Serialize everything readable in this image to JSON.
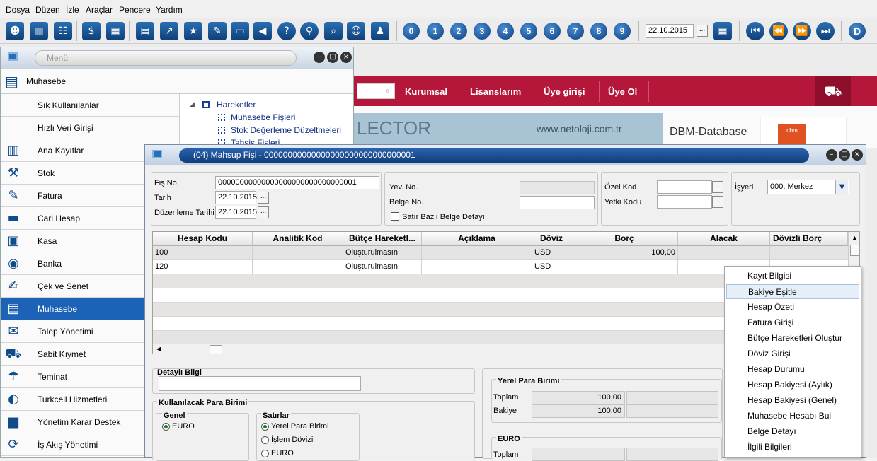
{
  "menubar": [
    "Dosya",
    "Düzen",
    "İzle",
    "Araçlar",
    "Pencere",
    "Yardım"
  ],
  "toolbar": {
    "icons": [
      "users-icon",
      "buildings-icon",
      "hierarchy-icon",
      "money-bag-icon",
      "calculator-icon",
      "calendar-icon",
      "chart-icon",
      "star-document-icon",
      "document-edit-icon",
      "folder-add-icon",
      "megaphone-icon",
      "help-icon",
      "connection-icon",
      "search-icon",
      "group-icon",
      "user-support-icon"
    ],
    "numbers": [
      "0",
      "1",
      "2",
      "3",
      "4",
      "5",
      "6",
      "7",
      "8",
      "9"
    ],
    "date": "22.10.2015",
    "date_btn": "...",
    "nav": [
      "⏮",
      "⏪",
      "⏩",
      "⏭"
    ],
    "d_button": "D"
  },
  "website": {
    "nav": [
      "Kurumsal",
      "Lisanslarım",
      "Üye girişi",
      "Üye Ol"
    ],
    "banner_text": "LECTOR",
    "url": "www.netoloji.com.tr",
    "dbm_text": "DBM-Database",
    "dbm_box": "dbm"
  },
  "menu_window": {
    "caption": "Menü",
    "header": "Muhasebe",
    "items": [
      {
        "label": "Sık Kullanılanlar",
        "icon": ""
      },
      {
        "label": "Hızlı Veri Girişi",
        "icon": ""
      },
      {
        "label": "Ana Kayıtlar",
        "icon": "binders-icon"
      },
      {
        "label": "Stok",
        "icon": "hand-truck-icon"
      },
      {
        "label": "Fatura",
        "icon": "invoice-icon"
      },
      {
        "label": "Cari Hesap",
        "icon": "card-icon"
      },
      {
        "label": "Kasa",
        "icon": "safe-icon"
      },
      {
        "label": "Banka",
        "icon": "coins-icon"
      },
      {
        "label": "Çek ve Senet",
        "icon": "check-icon"
      },
      {
        "label": "Muhasebe",
        "icon": "ledger-icon"
      },
      {
        "label": "Talep Yönetimi",
        "icon": "request-icon"
      },
      {
        "label": "Sabit Kıymet",
        "icon": "truck-icon"
      },
      {
        "label": "Teminat",
        "icon": "umbrella-icon"
      },
      {
        "label": "Turkcell Hizmetleri",
        "icon": "turkcell-icon"
      },
      {
        "label": "Yönetim Karar Destek",
        "icon": "bar-chart-icon"
      },
      {
        "label": "İş Akış Yönetimi",
        "icon": "workflow-icon"
      }
    ],
    "selected_index": 9,
    "tree": {
      "root": "Hareketler",
      "children": [
        "Muhasebe Fişleri",
        "Stok Değerleme Düzeltmeleri",
        "Tahsis Fişleri"
      ]
    }
  },
  "mahsup": {
    "title": "(04) Mahsup Fişi - 00000000000000000000000000000001",
    "fis_no_label": "Fiş No.",
    "fis_no": "00000000000000000000000000000001",
    "tarih_label": "Tarih",
    "tarih": "22.10.2015",
    "duzenleme_label": "Düzenleme Tarihi",
    "duzenleme": "22.10.2015",
    "yev_label": "Yev. No.",
    "belge_label": "Belge No.",
    "satir_bazli": "Satır Bazlı Belge Detayı",
    "ozel_kod_label": "Özel Kod",
    "yetki_kodu_label": "Yetki Kodu",
    "isyeri_label": "İşyeri",
    "isyeri": "000, Merkez",
    "columns": [
      "Hesap Kodu",
      "Analitik Kod",
      "Bütçe Hareketl...",
      "Açıklama",
      "Döviz",
      "Borç",
      "Alacak",
      "Dövizli Borç"
    ],
    "rows": [
      [
        "100",
        "",
        "Oluşturulmasın",
        "",
        "USD",
        "100,00",
        "",
        ""
      ],
      [
        "120",
        "",
        "Oluşturulmasın",
        "",
        "USD",
        "",
        "",
        ""
      ]
    ],
    "detayli_bilgi": "Detaylı Bilgi",
    "kullanilacak": "Kullanılacak Para Birimi",
    "genel_label": "Genel",
    "genel_option": "EURO",
    "satirlar_label": "Satırlar",
    "satirlar_options": [
      "Yerel Para Birimi",
      "İşlem Dövizi",
      "EURO"
    ],
    "yerel_label": "Yerel Para Birimi",
    "toplam_label": "Toplam",
    "toplam": "100,00",
    "bakiye_label": "Bakiye",
    "bakiye": "100,00",
    "euro_label": "EURO",
    "euro_toplam_label": "Toplam"
  },
  "context_menu": {
    "items": [
      "Kayıt Bilgisi",
      "Bakiye Eşitle",
      "Hesap Özeti",
      "Fatura Girişi",
      "Bütçe Hareketleri Oluştur",
      "Döviz Girişi",
      "Hesap Durumu",
      "Hesap Bakiyesi (Aylık)",
      "Hesap Bakiyesi (Genel)",
      "Muhasebe Hesabı Bul",
      "Belge Detayı",
      "İlgili Bilgileri"
    ],
    "highlighted_index": 1
  }
}
